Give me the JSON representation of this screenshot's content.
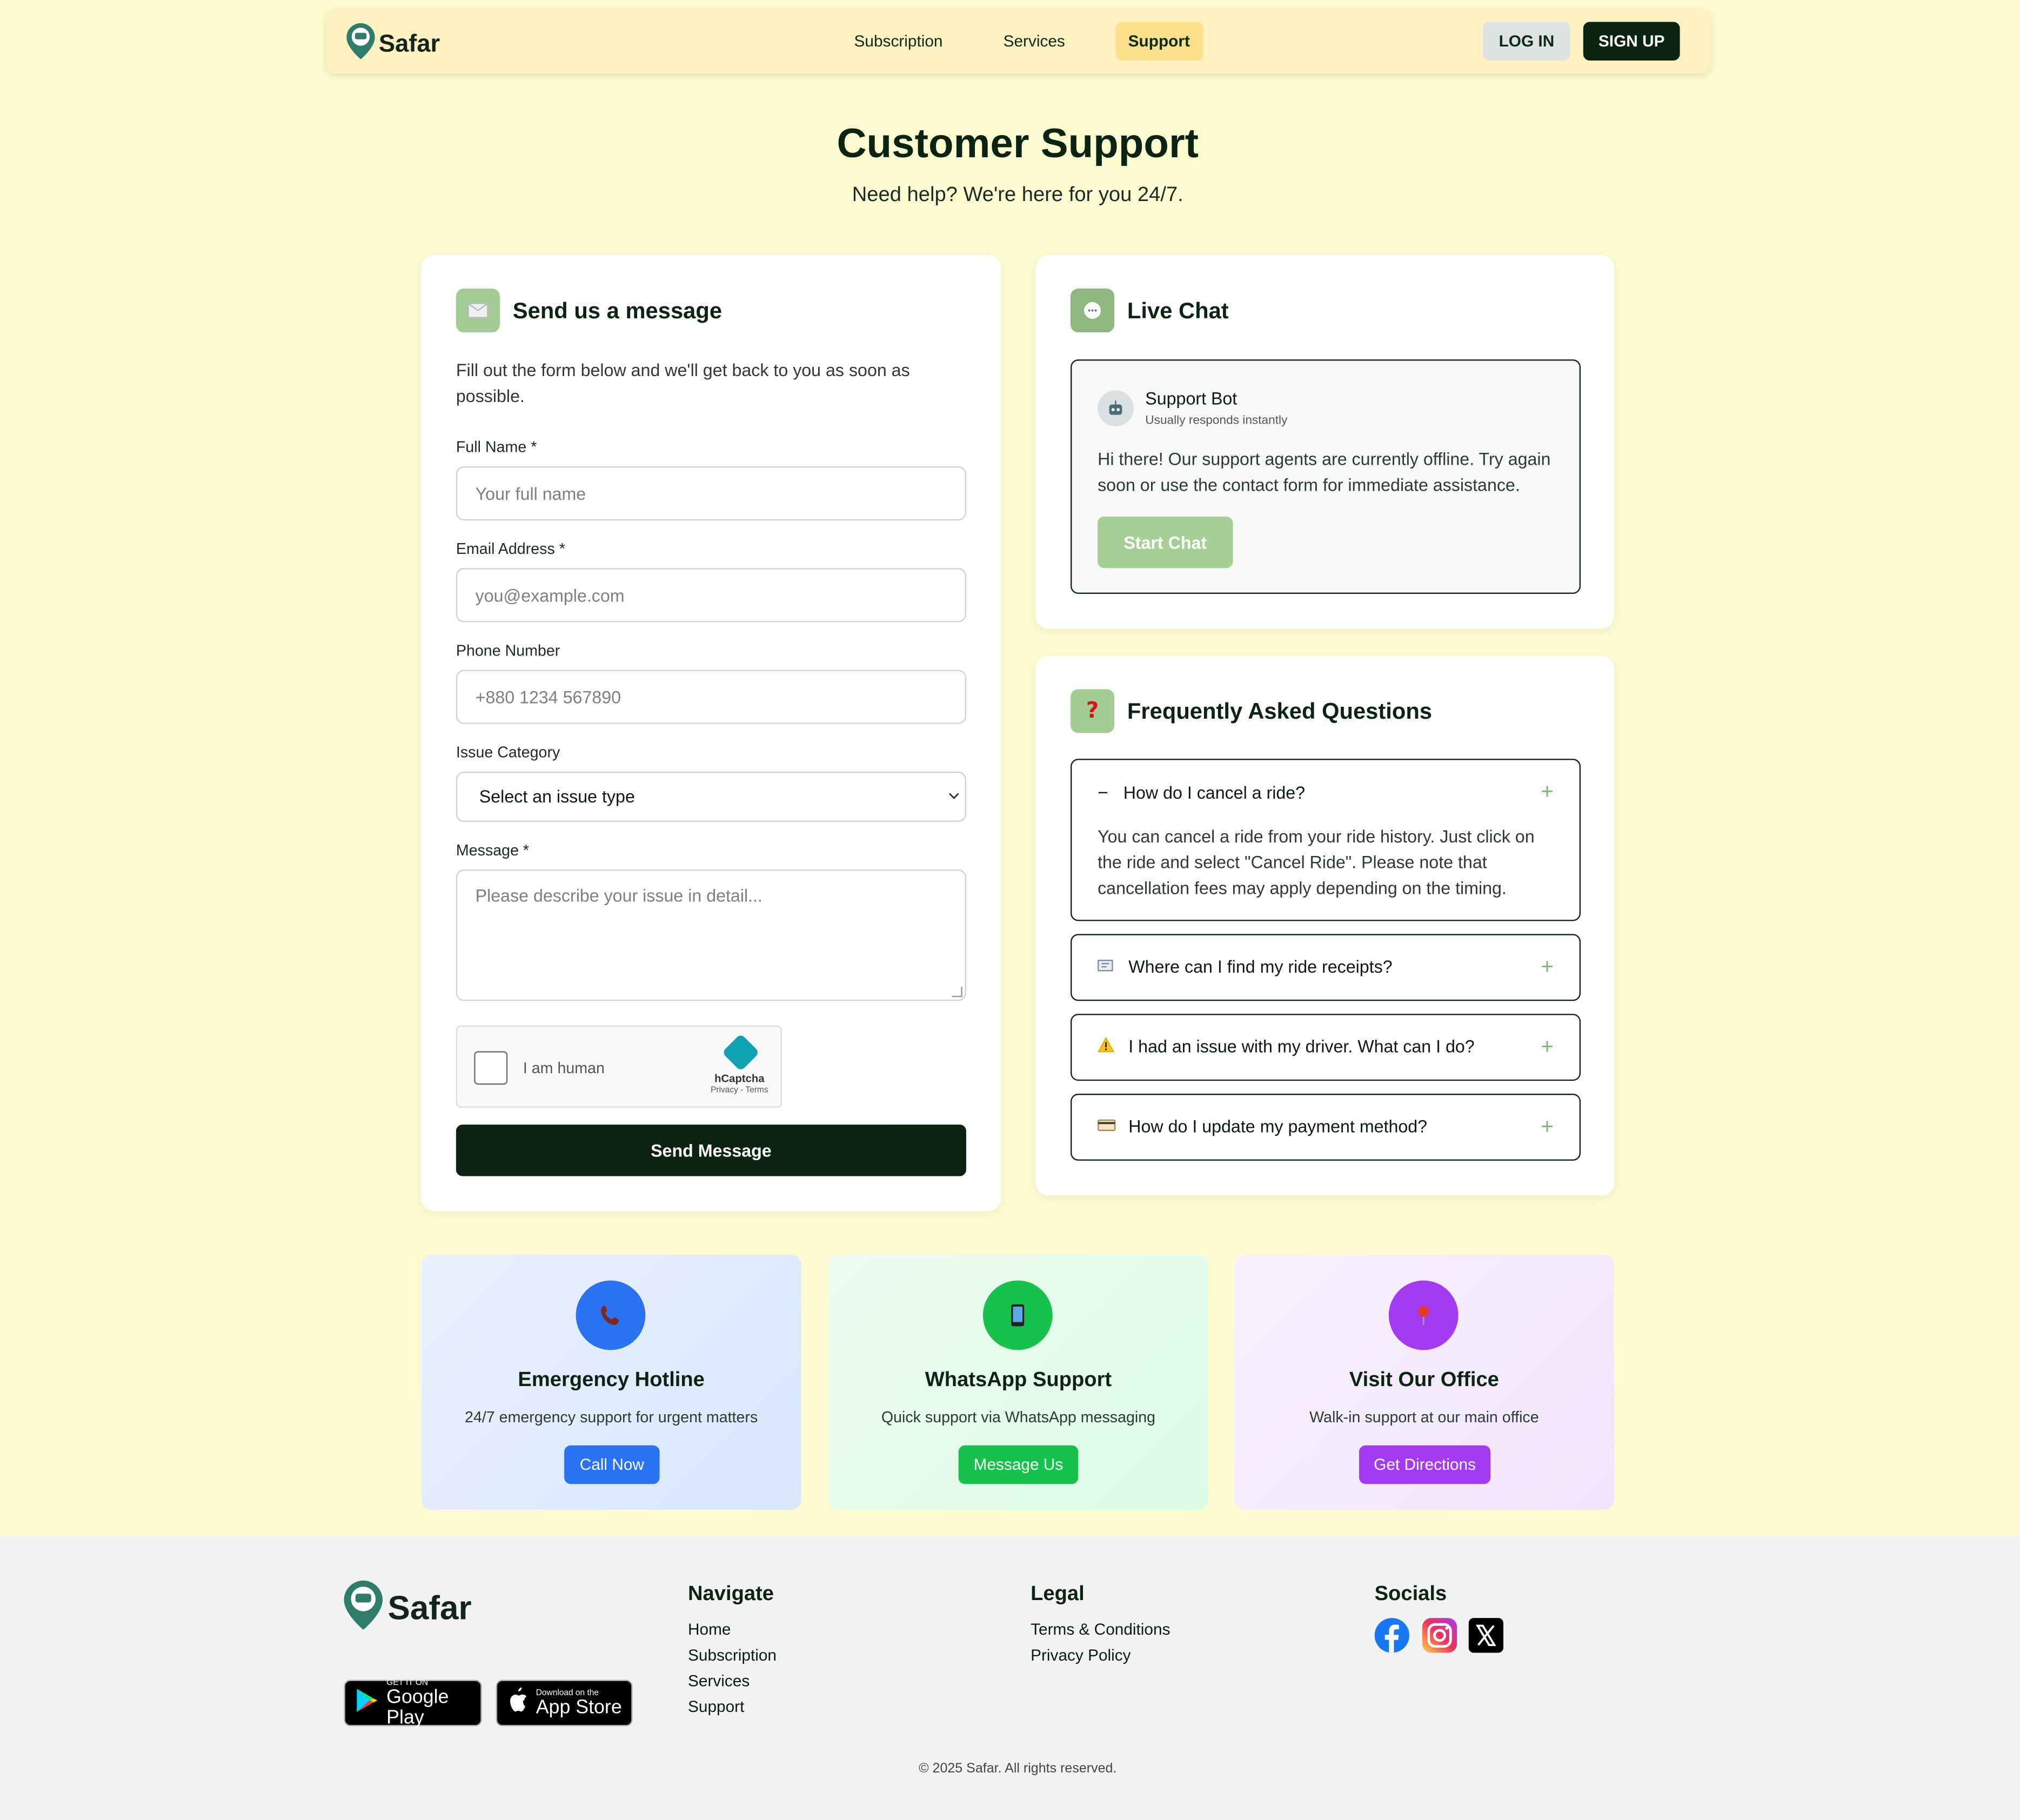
{
  "nav": {
    "brand": "Safar",
    "links": [
      "Subscription",
      "Services",
      "Support"
    ],
    "active": "Support",
    "login": "LOG IN",
    "signup": "SIGN UP"
  },
  "hero": {
    "title": "Customer Support",
    "subtitle": "Need help? We're here for you 24/7."
  },
  "form": {
    "title": "Send us a message",
    "icon": "envelope-icon",
    "description": "Fill out the form below and we'll get back to you as soon as possible.",
    "name_label": "Full Name *",
    "name_placeholder": "Your full name",
    "email_label": "Email Address *",
    "email_placeholder": "you@example.com",
    "phone_label": "Phone Number",
    "phone_placeholder": "+880 1234 567890",
    "category_label": "Issue Category",
    "category_value": "Select an issue type",
    "message_label": "Message *",
    "message_placeholder": "Please describe your issue in detail...",
    "captcha_label": "I am human",
    "captcha_brand": "hCaptcha",
    "captcha_links": "Privacy - Terms",
    "submit": "Send Message"
  },
  "chat": {
    "title": "Live Chat",
    "icon": "speech-bubble-icon",
    "bot_name": "Support Bot",
    "bot_status": "Usually responds instantly",
    "message": "Hi there! Our support agents are currently offline. Try again soon or use the contact form for immediate assistance.",
    "button": "Start Chat"
  },
  "faq": {
    "title": "Frequently Asked Questions",
    "icon": "question-mark-icon",
    "items": [
      {
        "icon": "minus",
        "question": "How do I cancel a ride?",
        "answer": "You can cancel a ride from your ride history. Just click on the ride and select \"Cancel Ride\". Please note that cancellation fees may apply depending on the timing.",
        "expanded": true
      },
      {
        "icon": "receipt-icon",
        "question": "Where can I find my ride receipts?",
        "expanded": false
      },
      {
        "icon": "warning-icon",
        "question": "I had an issue with my driver. What can I do?",
        "expanded": false
      },
      {
        "icon": "credit-card-icon",
        "question": "How do I update my payment method?",
        "expanded": false
      }
    ]
  },
  "contacts": [
    {
      "title": "Emergency Hotline",
      "desc": "24/7 emergency support for urgent matters",
      "button": "Call Now",
      "icon": "phone-icon",
      "color": "#2a73f0"
    },
    {
      "title": "WhatsApp Support",
      "desc": "Quick support via WhatsApp messaging",
      "button": "Message Us",
      "icon": "mobile-phone-icon",
      "color": "#16c24b"
    },
    {
      "title": "Visit Our Office",
      "desc": "Walk-in support at our main office",
      "button": "Get Directions",
      "icon": "map-pin-icon",
      "color": "#a43bf1"
    }
  ],
  "footer": {
    "brand": "Safar",
    "google_play_small": "GET IT ON",
    "google_play_big": "Google Play",
    "app_store_small": "Download on the",
    "app_store_big": "App Store",
    "navigate_title": "Navigate",
    "navigate_links": [
      "Home",
      "Subscription",
      "Services",
      "Support"
    ],
    "legal_title": "Legal",
    "legal_links": [
      "Terms & Conditions",
      "Privacy Policy"
    ],
    "socials_title": "Socials",
    "copyright": "© 2025 Safar. All rights reserved."
  },
  "colors": {
    "page_bg": "#fdfbd0",
    "nav_bg": "#fdf1c1",
    "primary_dark": "#0b2412",
    "accent_green": "#a3cb93",
    "active_nav": "#fde08a"
  }
}
